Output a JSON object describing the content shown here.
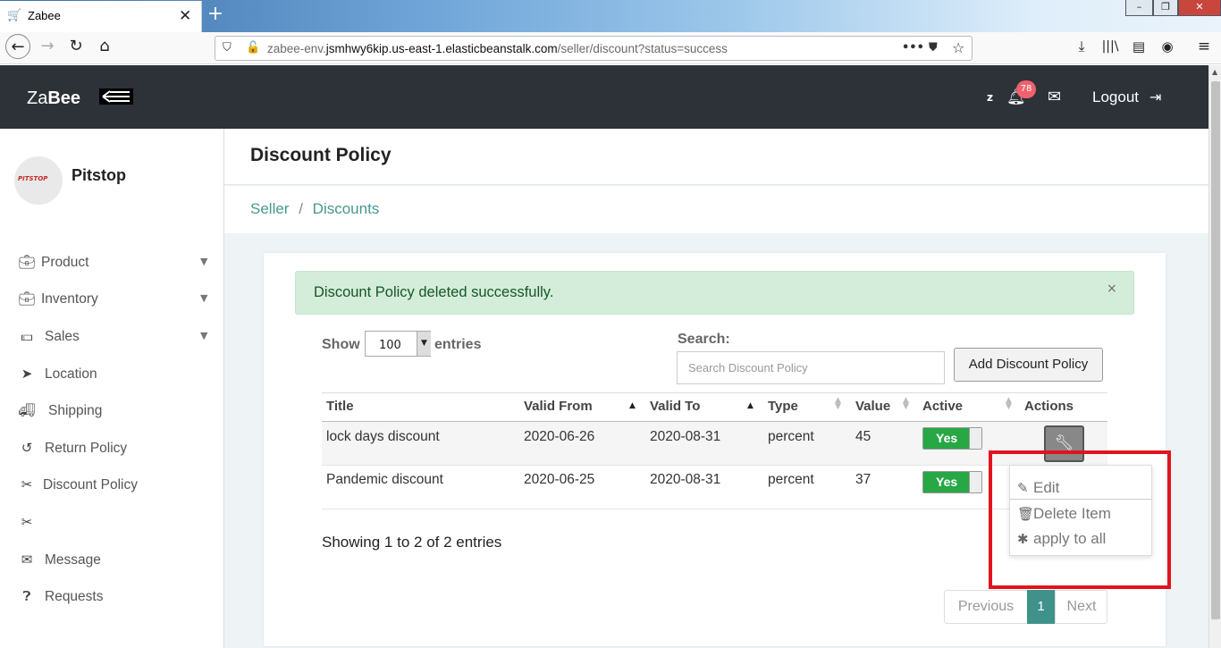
{
  "browser": {
    "tab_title": "Zabee",
    "url_prefix": "zabee-env.",
    "url_domain": "jsmhwy6kip.us-east-1.elasticbeanstalk.com",
    "url_path": "/seller/discount?status=success"
  },
  "header": {
    "logo_light": "Za",
    "logo_bold": "Bee",
    "user_initial": "z",
    "notification_count": "78",
    "logout_label": "Logout"
  },
  "sidebar": {
    "store_name": "Pitstop",
    "logo_text": "PITSTOP",
    "items": [
      {
        "label": "Product",
        "icon": "briefcase-icon"
      },
      {
        "label": "Inventory",
        "icon": "briefcase-icon"
      },
      {
        "label": "Sales",
        "icon": "money-icon"
      },
      {
        "label": "Location",
        "icon": "location-arrow-icon"
      },
      {
        "label": "Shipping",
        "icon": "truck-icon"
      },
      {
        "label": "Return Policy",
        "icon": "undo-icon"
      },
      {
        "label": "Discount Policy",
        "icon": "scissors-icon"
      },
      {
        "label": "",
        "icon": "scissors-icon"
      },
      {
        "label": "Message",
        "icon": "envelope-icon"
      },
      {
        "label": "Requests",
        "icon": "question-circle-icon"
      }
    ]
  },
  "page": {
    "title": "Discount Policy",
    "breadcrumb_1": "Seller",
    "breadcrumb_sep": "/",
    "breadcrumb_2": "Discounts"
  },
  "alert": {
    "message": "Discount Policy deleted successfully.",
    "close": "×"
  },
  "table_controls": {
    "show_label": "Show",
    "page_length": "100",
    "entries_label": "entries",
    "search_label": "Search:",
    "search_placeholder": "Search Discount Policy",
    "add_button": "Add Discount Policy"
  },
  "table": {
    "columns": [
      "Title",
      "Valid From",
      "Valid To",
      "Type",
      "Value",
      "Active",
      "Actions"
    ],
    "rows": [
      {
        "title": "lock days discount",
        "valid_from": "2020-06-26",
        "valid_to": "2020-08-31",
        "type": "percent",
        "value": "45",
        "active": "Yes"
      },
      {
        "title": "Pandemic discount",
        "valid_from": "2020-06-25",
        "valid_to": "2020-08-31",
        "type": "percent",
        "value": "37",
        "active": "Yes"
      }
    ]
  },
  "action_menu": {
    "edit": "Edit",
    "delete": "Delete Item",
    "apply_all": "apply to all"
  },
  "footer": {
    "info": "Showing 1 to 2 of 2 entries",
    "previous": "Previous",
    "page": "1",
    "next": "Next"
  },
  "colors": {
    "header_bg": "#2d3238",
    "accent": "#3f9289",
    "active_toggle": "#28a745",
    "highlight_box": "#e0141e",
    "badge": "#f0616d"
  }
}
